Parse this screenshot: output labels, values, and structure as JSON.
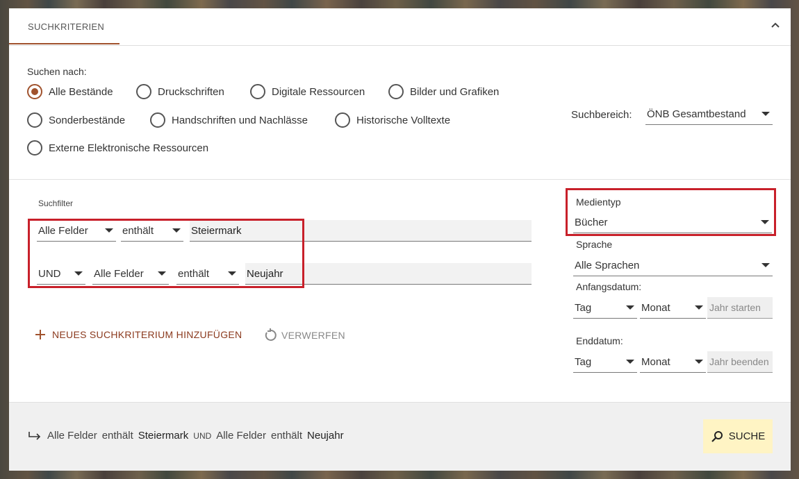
{
  "tab": {
    "label": "SUCHKRITERIEN"
  },
  "search_for": {
    "label": "Suchen nach:",
    "options": [
      {
        "label": "Alle Bestände",
        "checked": true
      },
      {
        "label": "Druckschriften",
        "checked": false
      },
      {
        "label": "Digitale Ressourcen",
        "checked": false
      },
      {
        "label": "Bilder und Grafiken",
        "checked": false
      },
      {
        "label": "Sonderbestände",
        "checked": false
      },
      {
        "label": "Handschriften und Nachlässe",
        "checked": false
      },
      {
        "label": "Historische Volltexte",
        "checked": false
      },
      {
        "label": "Externe Elektronische Ressourcen",
        "checked": false
      }
    ]
  },
  "scope": {
    "label": "Suchbereich:",
    "value": "ÖNB Gesamtbestand"
  },
  "filters": {
    "label": "Suchfilter",
    "row1": {
      "field": "Alle Felder",
      "operator": "enthält",
      "value": "Steiermark"
    },
    "row2": {
      "boolean": "UND",
      "field": "Alle Felder",
      "operator": "enthält",
      "value": "Neujahr"
    }
  },
  "actions": {
    "add": "NEUES SUCHKRITERIUM HINZUFÜGEN",
    "discard": "VERWERFEN"
  },
  "facets": {
    "media_type": {
      "label": "Medientyp",
      "value": "Bücher"
    },
    "language": {
      "label": "Sprache",
      "value": "Alle Sprachen"
    },
    "start_date": {
      "label": "Anfangsdatum:",
      "day": "Tag",
      "month": "Monat",
      "year_placeholder": "Jahr starten"
    },
    "end_date": {
      "label": "Enddatum:",
      "day": "Tag",
      "month": "Monat",
      "year_placeholder": "Jahr beenden"
    }
  },
  "summary": {
    "f1": "Alle Felder",
    "op1": "enthält",
    "v1": "Steiermark",
    "bool": "UND",
    "f2": "Alle Felder",
    "op2": "enthält",
    "v2": "Neujahr"
  },
  "search_button": {
    "label": "SUCHE"
  },
  "colors": {
    "accent": "#a0522d",
    "highlight": "#c8202a",
    "search_button_bg": "#fff4c4"
  }
}
